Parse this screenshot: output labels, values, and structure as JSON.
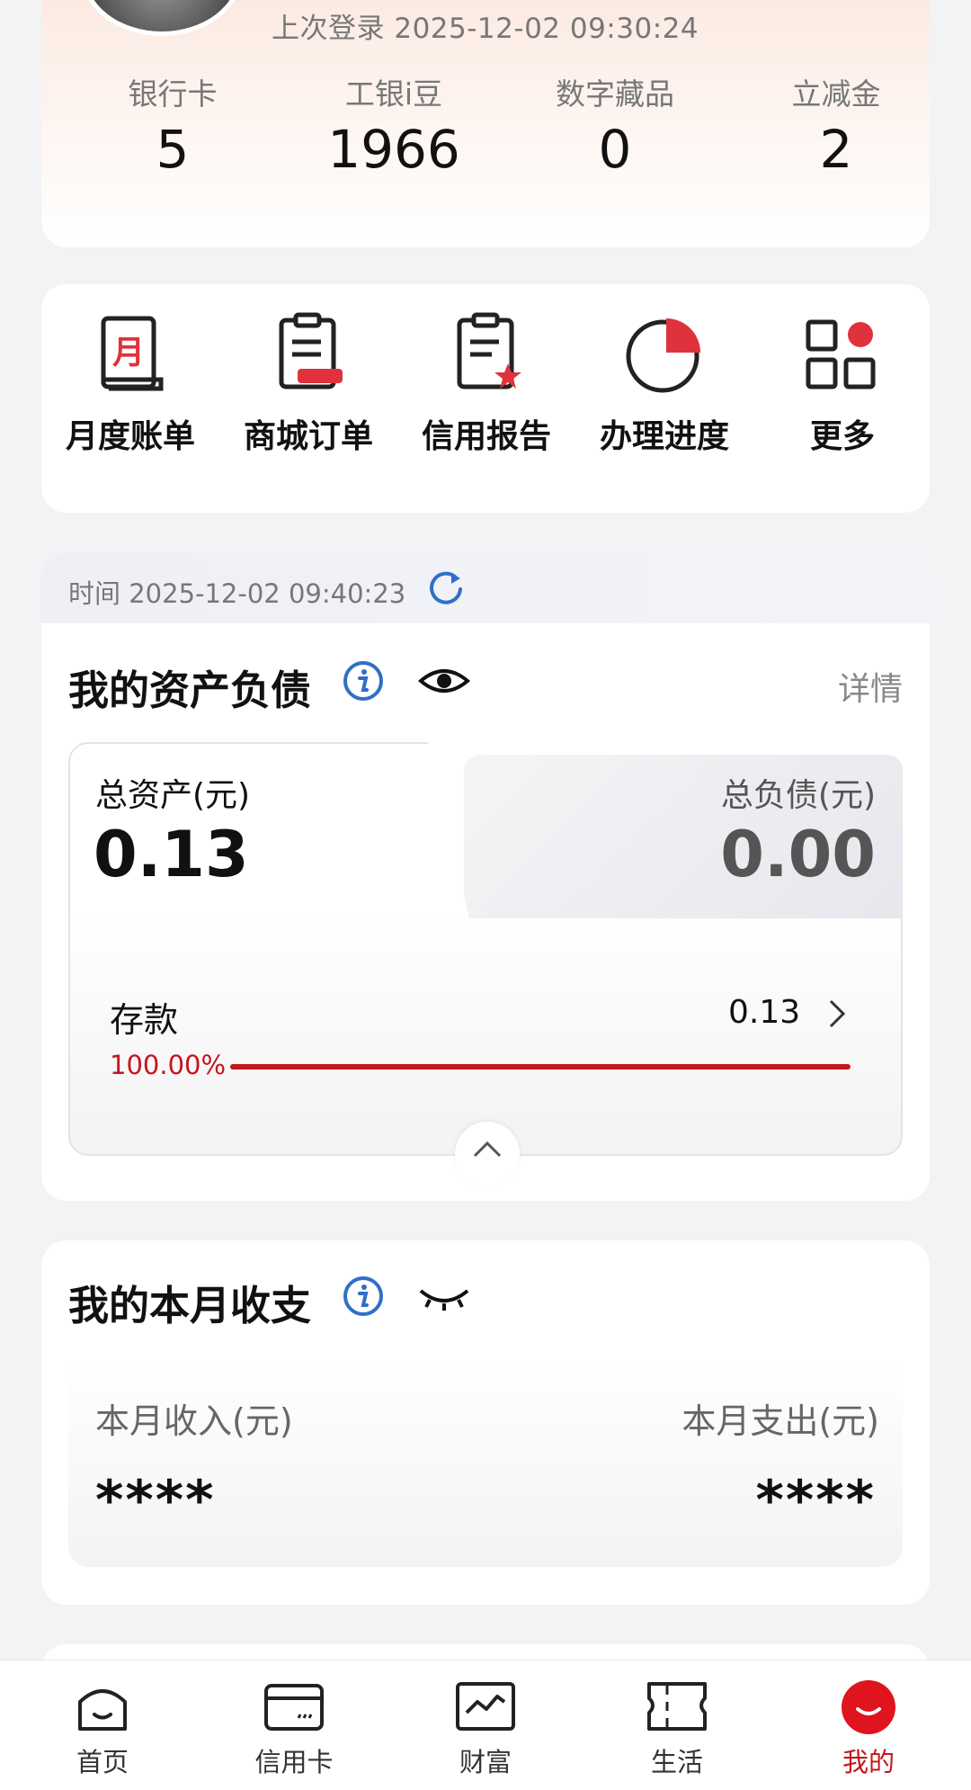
{
  "profile": {
    "last_login": "上次登录 2025-12-02 09:30:24",
    "stats": [
      {
        "label": "银行卡",
        "value": "5"
      },
      {
        "label": "工银i豆",
        "value": "1966"
      },
      {
        "label": "数字藏品",
        "value": "0"
      },
      {
        "label": "立减金",
        "value": "2"
      }
    ]
  },
  "quick_actions": [
    {
      "label": "月度账单",
      "icon": "monthly-bill-icon"
    },
    {
      "label": "商城订单",
      "icon": "mall-order-icon"
    },
    {
      "label": "信用报告",
      "icon": "credit-report-icon"
    },
    {
      "label": "办理进度",
      "icon": "progress-pie-icon"
    },
    {
      "label": "更多",
      "icon": "more-grid-icon"
    }
  ],
  "assets": {
    "time": "时间 2025-12-02 09:40:23",
    "title": "我的资产负债",
    "details": "详情",
    "total_assets_label": "总资产(元)",
    "total_assets_value": "0.13",
    "total_liabilities_label": "总负债(元)",
    "total_liabilities_value": "0.00",
    "deposit": {
      "label": "存款",
      "value": "0.13",
      "percent_text": "100.00%",
      "percent": 100
    }
  },
  "monthly": {
    "title": "我的本月收支",
    "income_label": "本月收入(元)",
    "income_value": "****",
    "expense_label": "本月支出(元)",
    "expense_value": "****"
  },
  "nav": [
    {
      "label": "首页",
      "icon": "home-icon",
      "active": false
    },
    {
      "label": "信用卡",
      "icon": "credit-card-icon",
      "active": false
    },
    {
      "label": "财富",
      "icon": "wealth-icon",
      "active": false
    },
    {
      "label": "生活",
      "icon": "life-icon",
      "active": false
    },
    {
      "label": "我的",
      "icon": "me-icon",
      "active": true
    }
  ],
  "colors": {
    "accent_red": "#c4161c",
    "info_blue": "#2f6fc8",
    "background": "#f3f3f6"
  }
}
